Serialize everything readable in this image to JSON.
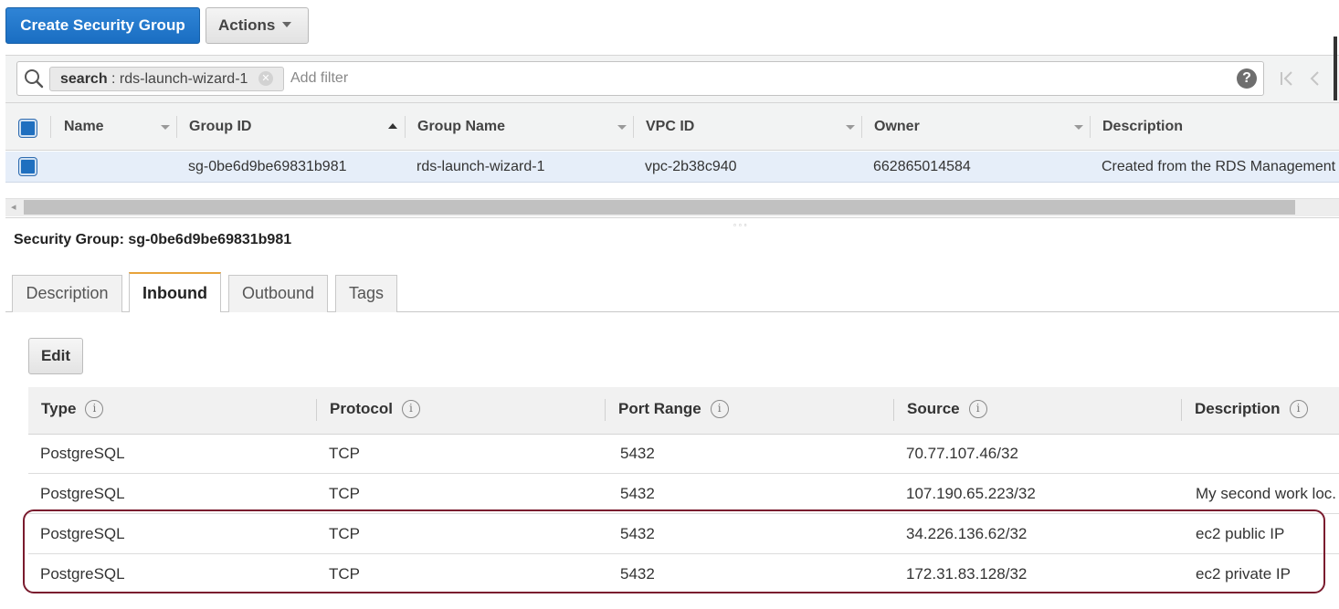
{
  "toolbar": {
    "create_label": "Create Security Group",
    "actions_label": "Actions"
  },
  "filter": {
    "token_key": "search",
    "token_value": " : rds-launch-wizard-1",
    "add_filter_placeholder": "Add filter",
    "help_glyph": "?",
    "first_glyph": "|<",
    "prev_glyph": "<"
  },
  "grid": {
    "columns": [
      "Name",
      "Group ID",
      "Group Name",
      "VPC ID",
      "Owner",
      "Description"
    ],
    "sorted_column": "Group ID",
    "rows": [
      {
        "name": "",
        "group_id": "sg-0be6d9be69831b981",
        "group_name": "rds-launch-wizard-1",
        "vpc_id": "vpc-2b38c940",
        "owner": "662865014584",
        "description": "Created from the RDS Management"
      }
    ]
  },
  "details": {
    "title": "Security Group: sg-0be6d9be69831b981",
    "tabs": [
      "Description",
      "Inbound",
      "Outbound",
      "Tags"
    ],
    "active_tab": "Inbound",
    "edit_label": "Edit"
  },
  "rules": {
    "columns": [
      "Type",
      "Protocol",
      "Port Range",
      "Source",
      "Description"
    ],
    "info_glyph": "i",
    "rows": [
      {
        "type": "PostgreSQL",
        "protocol": "TCP",
        "port": "5432",
        "source": "70.77.107.46/32",
        "description": ""
      },
      {
        "type": "PostgreSQL",
        "protocol": "TCP",
        "port": "5432",
        "source": "107.190.65.223/32",
        "description": "My second work loc."
      },
      {
        "type": "PostgreSQL",
        "protocol": "TCP",
        "port": "5432",
        "source": "34.226.136.62/32",
        "description": "ec2 public IP"
      },
      {
        "type": "PostgreSQL",
        "protocol": "TCP",
        "port": "5432",
        "source": "172.31.83.128/32",
        "description": "ec2 private IP"
      }
    ]
  },
  "colors": {
    "primary": "#1a6ec2",
    "selected_row": "#e6eef9",
    "active_tab_accent": "#e8a33a",
    "highlight_border": "#7a1b2e"
  }
}
